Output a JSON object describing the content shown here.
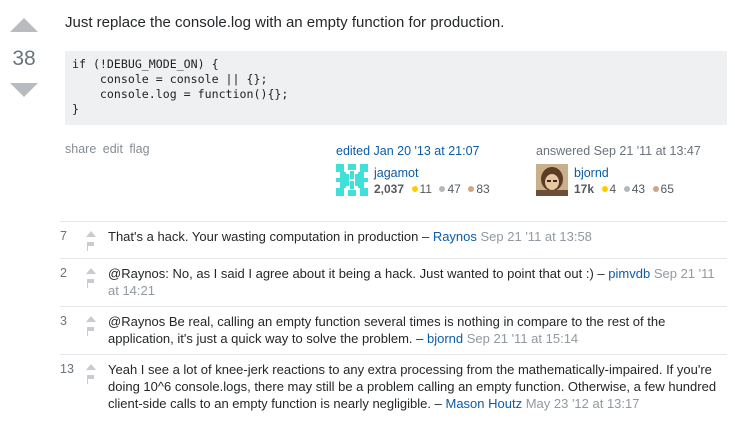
{
  "answer": {
    "score": "38",
    "text": "Just replace the console.log with an empty function for production.",
    "code": "if (!DEBUG_MODE_ON) {\n    console = console || {};\n    console.log = function(){};\n}"
  },
  "post_menu": {
    "share": "share",
    "edit": "edit",
    "flag": "flag"
  },
  "editor": {
    "action": "edited Jan 20 '13 at 21:07",
    "name": "jagamot",
    "rep": "2,037",
    "gold": "11",
    "silver": "47",
    "bronze": "83"
  },
  "author": {
    "action": "answered Sep 21 '11 at 13:47",
    "name": "bjornd",
    "rep": "17k",
    "gold": "4",
    "silver": "43",
    "bronze": "65"
  },
  "colors": {
    "gold": "#ffcc01",
    "silver": "#b4b8bc",
    "bronze": "#d1a684",
    "link": "#0c5ba8"
  },
  "comments": [
    {
      "score": "7",
      "text": "That's a hack. Your wasting computation in production",
      "user": "Raynos",
      "date": "Sep 21 '11 at 13:58"
    },
    {
      "score": "2",
      "text": "@Raynos: No, as I said I agree about it being a hack. Just wanted to point that out :)",
      "user": "pimvdb",
      "date": "Sep 21 '11 at 14:21"
    },
    {
      "score": "3",
      "text": "@Raynos Be real, calling an empty function several times is nothing in compare to the rest of the application, it's just a quick way to solve the problem.",
      "user": "bjornd",
      "date": "Sep 21 '11 at 15:14"
    },
    {
      "score": "13",
      "text": "Yeah I see a lot of knee-jerk reactions to any extra processing from the mathematically-impaired. If you're doing 10^6 console.logs, there may still be a problem calling an empty function. Otherwise, a few hundred client-side calls to an empty function is nearly negligible.",
      "user": "Mason Houtz",
      "date": "May 23 '12 at 13:17"
    }
  ],
  "separator": " – "
}
